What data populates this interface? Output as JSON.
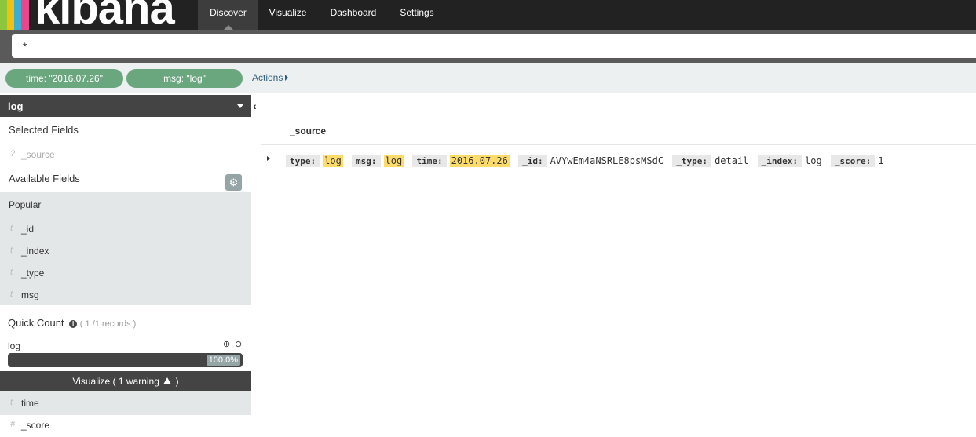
{
  "app": {
    "logo_text": "kibana",
    "brand_colors": [
      "#e8488b",
      "#f2c10f",
      "#3caed2",
      "#8cc63e",
      "#f04e98"
    ]
  },
  "nav": {
    "tabs": [
      {
        "label": "Discover",
        "active": true
      },
      {
        "label": "Visualize",
        "active": false
      },
      {
        "label": "Dashboard",
        "active": false
      },
      {
        "label": "Settings",
        "active": false
      }
    ]
  },
  "search": {
    "value": "*"
  },
  "filters": {
    "pills": [
      {
        "label": "time: \"2016.07.26\""
      },
      {
        "label": "msg: \"log\""
      }
    ],
    "actions_label": "Actions"
  },
  "sidebar": {
    "index_pattern": "log",
    "selected_fields_title": "Selected Fields",
    "selected_fields": [
      {
        "type": "?",
        "name": "_source"
      }
    ],
    "available_fields_title": "Available Fields",
    "popular_title": "Popular",
    "popular_fields": [
      {
        "type": "t",
        "name": "_id"
      },
      {
        "type": "t",
        "name": "_index"
      },
      {
        "type": "t",
        "name": "_type"
      },
      {
        "type": "t",
        "name": "msg"
      }
    ],
    "quick_count": {
      "title": "Quick Count",
      "records": "( 1 /1 records )",
      "value_label": "log",
      "percent_text": "100.0%",
      "percent": 100
    },
    "visualize_button": {
      "prefix": "Visualize ( 1 warning",
      "suffix": ")"
    },
    "other_fields": [
      {
        "type": "t",
        "name": "time"
      },
      {
        "type": "#",
        "name": "_score"
      }
    ]
  },
  "main": {
    "column_header": "_source",
    "document": [
      {
        "key": "type:",
        "value": "log",
        "highlight": true
      },
      {
        "key": "msg:",
        "value": "log",
        "highlight": true
      },
      {
        "key": "time:",
        "value": "2016.07.26",
        "highlight": true
      },
      {
        "key": "_id:",
        "value": "AVYwEm4aNSRLE8psMSdC",
        "highlight": false
      },
      {
        "key": "_type:",
        "value": "detail",
        "highlight": false
      },
      {
        "key": "_index:",
        "value": "log",
        "highlight": false
      },
      {
        "key": "_score:",
        "value": "1",
        "highlight": false
      }
    ]
  }
}
